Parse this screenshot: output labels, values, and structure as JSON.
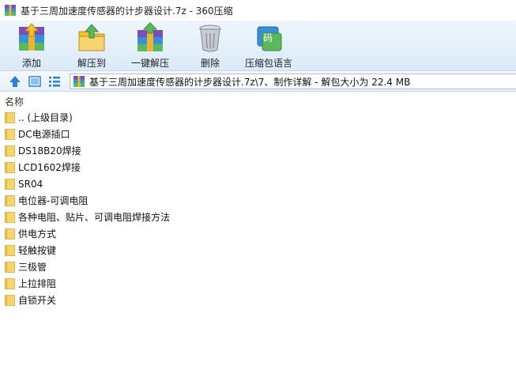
{
  "window": {
    "title": "基于三周加速度传感器的计步器设计.7z - 360压缩"
  },
  "toolbar": {
    "add_label": "添加",
    "extract_to_label": "解压到",
    "one_click_extract_label": "一键解压",
    "delete_label": "删除",
    "archive_language_label": "压缩包语言",
    "language_icon_glyph": "码"
  },
  "addressbar": {
    "path": "基于三周加速度传感器的计步器设计.7z\\7、制作详解 - 解包大小为 22.4 MB"
  },
  "filelist": {
    "column_name": "名称",
    "items": [
      ".. (上级目录)",
      "DC电源插口",
      "DS18B20焊接",
      "LCD1602焊接",
      "SR04",
      "电位器-可调电阻",
      "各种电阻、贴片、可调电阻焊接方法",
      "供电方式",
      "轻触按键",
      "三极管",
      "上拉排阻",
      "自锁开关"
    ]
  },
  "colors": {
    "folder": "#f6d472",
    "folder_dark": "#e3b84a",
    "toolbar_bg": "#dbeaf8",
    "nav_blue": "#2f80d1"
  }
}
